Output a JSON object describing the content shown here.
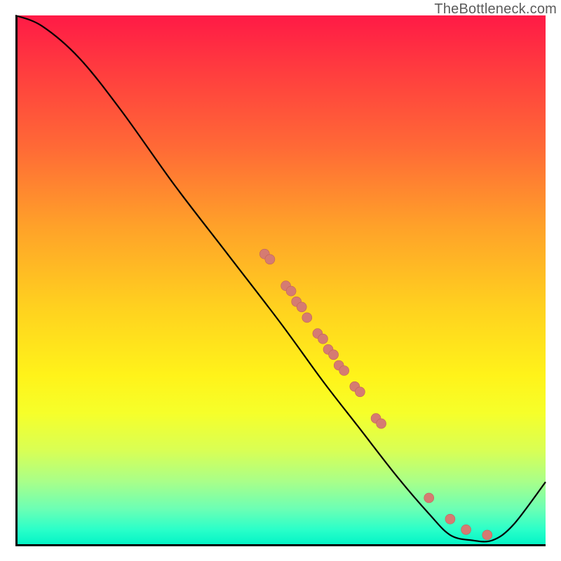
{
  "watermark": "TheBottleneck.com",
  "chart_data": {
    "type": "line",
    "title": "",
    "xlabel": "",
    "ylabel": "",
    "xlim": [
      0,
      100
    ],
    "ylim": [
      0,
      100
    ],
    "background_gradient_meaning": "red-high to green-low",
    "curve": [
      {
        "x": 0,
        "y": 100
      },
      {
        "x": 5,
        "y": 98
      },
      {
        "x": 12,
        "y": 92
      },
      {
        "x": 20,
        "y": 82
      },
      {
        "x": 30,
        "y": 68
      },
      {
        "x": 40,
        "y": 55
      },
      {
        "x": 50,
        "y": 42
      },
      {
        "x": 58,
        "y": 31
      },
      {
        "x": 65,
        "y": 22
      },
      {
        "x": 72,
        "y": 13
      },
      {
        "x": 78,
        "y": 6
      },
      {
        "x": 82,
        "y": 2
      },
      {
        "x": 86,
        "y": 1
      },
      {
        "x": 90,
        "y": 1
      },
      {
        "x": 94,
        "y": 4
      },
      {
        "x": 100,
        "y": 12
      }
    ],
    "series": [
      {
        "name": "data-points",
        "points": [
          {
            "x": 47,
            "y": 55
          },
          {
            "x": 48,
            "y": 54
          },
          {
            "x": 51,
            "y": 49
          },
          {
            "x": 52,
            "y": 48
          },
          {
            "x": 53,
            "y": 46
          },
          {
            "x": 54,
            "y": 45
          },
          {
            "x": 55,
            "y": 43
          },
          {
            "x": 57,
            "y": 40
          },
          {
            "x": 58,
            "y": 39
          },
          {
            "x": 59,
            "y": 37
          },
          {
            "x": 60,
            "y": 36
          },
          {
            "x": 61,
            "y": 34
          },
          {
            "x": 62,
            "y": 33
          },
          {
            "x": 64,
            "y": 30
          },
          {
            "x": 65,
            "y": 29
          },
          {
            "x": 68,
            "y": 24
          },
          {
            "x": 69,
            "y": 23
          },
          {
            "x": 78,
            "y": 9
          },
          {
            "x": 82,
            "y": 5
          },
          {
            "x": 85,
            "y": 3
          },
          {
            "x": 89,
            "y": 2
          }
        ]
      }
    ]
  }
}
